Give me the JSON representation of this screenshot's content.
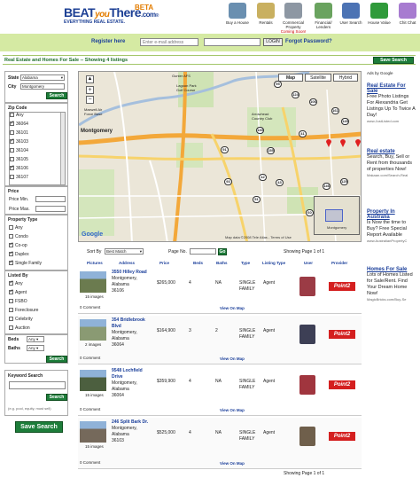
{
  "header": {
    "logo_beat": "BEAT",
    "logo_you": "you",
    "logo_there": "There",
    "logo_com": ".com",
    "logo_reg": "®",
    "tagline": "EVERYTHING REAL ESTATE.",
    "beta": "BETA",
    "nav": [
      {
        "label": "Buy a House",
        "icon": "house-icon"
      },
      {
        "label": "Rentals",
        "icon": "for-rent-sign-icon"
      },
      {
        "label": "Commercial Property",
        "sub": "Coming Soon!",
        "icon": "building-icon"
      },
      {
        "label": "Financial/ Lenders",
        "icon": "handshake-icon"
      },
      {
        "label": "User Search",
        "icon": "magnifier-icon"
      },
      {
        "label": "House Value",
        "icon": "dollar-icon"
      },
      {
        "label": "Chit Chat",
        "icon": "chat-icon"
      }
    ]
  },
  "login": {
    "register": "Register here",
    "email_placeholder": "Enter e-mail address",
    "login_button": "LOGIN",
    "forgot": "Forgot Password?"
  },
  "title": {
    "text": "Real Estate and Homes For Sale -- Showing 4 listings",
    "save_search": "Save Search"
  },
  "sidebar": {
    "state_label": "State",
    "state_value": "Alabama",
    "city_label": "City",
    "city_value": "Montgomery",
    "search_button": "Search",
    "zip_label": "Zip Code",
    "zips": [
      {
        "code": "Any",
        "checked": false
      },
      {
        "code": "36064",
        "checked": true
      },
      {
        "code": "36101",
        "checked": false
      },
      {
        "code": "36103",
        "checked": true
      },
      {
        "code": "36104",
        "checked": false
      },
      {
        "code": "36105",
        "checked": false
      },
      {
        "code": "36106",
        "checked": true
      },
      {
        "code": "36107",
        "checked": false
      }
    ],
    "price_label": "Price",
    "price_min": "Price Min.",
    "price_max": "Price Max.",
    "ptype_label": "Property Type",
    "ptypes": [
      {
        "name": "Any",
        "checked": false
      },
      {
        "name": "Condo",
        "checked": false
      },
      {
        "name": "Co-op",
        "checked": true
      },
      {
        "name": "Duplex",
        "checked": true
      },
      {
        "name": "Single Family",
        "checked": true
      }
    ],
    "listed_label": "Listed By",
    "listed": [
      {
        "name": "Any",
        "checked": true
      },
      {
        "name": "Agent",
        "checked": true
      },
      {
        "name": "FSBO",
        "checked": false
      },
      {
        "name": "Foreclosure",
        "checked": false
      },
      {
        "name": "Celebrity",
        "checked": false
      },
      {
        "name": "Auction",
        "checked": false
      }
    ],
    "beds_label": "Beds",
    "beds_value": "Any",
    "baths_label": "Baths",
    "baths_value": "Any",
    "search2": "Search",
    "keyword_label": "Keyword Search",
    "keyword_hint": "(e.g. pool, equity, must sell)",
    "search3": "Search",
    "save_search": "Save Search"
  },
  "map": {
    "tabs": [
      "Map",
      "Satellite",
      "Hybrid"
    ],
    "copyright": "Map data ©2008 Tele Atlas - Terms of Use",
    "google": "Google",
    "places": [
      "Gunter AFS",
      "Lagoon Park Golf Course",
      "Maxwell Air Force Base",
      "Arrowhead Country Club",
      "Montgomery",
      "Montgomery"
    ],
    "markers": [
      "95",
      "124",
      "106",
      "161",
      "130",
      "145",
      "41",
      "155",
      "91",
      "42",
      "93",
      "43",
      "146",
      "125",
      "51",
      "60"
    ]
  },
  "results": {
    "sort_label": "Sort By",
    "sort_value": "Best Match",
    "page_label": "Page No.",
    "go": "Go",
    "showing_top": "Showing Page 1 of 1",
    "showing_bottom": "Showing Page 1 of 1",
    "columns": [
      "Pictures",
      "Address",
      "Price",
      "Beds",
      "Baths",
      "Type",
      "Listing Type",
      "User",
      "Provider"
    ],
    "listings": [
      {
        "images": "15 images",
        "street": "3550 Hilley Road",
        "city": "Montgomery, Alabama",
        "zip": "36106",
        "price": "$265,000",
        "beds": "4",
        "baths": "NA",
        "type": "SINGLE FAMILY",
        "listing": "Agent",
        "comments": "0 Comment",
        "map": "View On Map"
      },
      {
        "images": "2 images",
        "street": "354 Bridlebrook Blvd",
        "city": "Montgomery, Alabama",
        "zip": "36064",
        "price": "$164,900",
        "beds": "3",
        "baths": "2",
        "type": "SINGLE FAMILY",
        "listing": "Agent",
        "comments": "0 Comment",
        "map": "View On Map"
      },
      {
        "images": "15 images",
        "street": "9548 Lochfield Drive",
        "city": "Montgomery, Alabama",
        "zip": "36064",
        "price": "$359,900",
        "beds": "4",
        "baths": "NA",
        "type": "SINGLE FAMILY",
        "listing": "Agent",
        "comments": "0 Comment",
        "map": "View On Map"
      },
      {
        "images": "15 images",
        "street": "246 Split Bark Dr.",
        "city": "Montgomery, Alabama",
        "zip": "36103",
        "price": "$525,000",
        "beds": "4",
        "baths": "NA",
        "type": "SINGLE FAMILY",
        "listing": "Agent",
        "comments": "0 Comment",
        "map": "View On Map"
      }
    ],
    "provider_logo": "Point2"
  },
  "ads": {
    "adsby": "Ads by Google",
    "items": [
      {
        "title": "Real Estate For Sale",
        "text": "Free Photo Listings For Alexandria Get Listings Up To Twice A Day!",
        "url": "www.JustListed.com"
      },
      {
        "title": "Real estate",
        "text": "Search, Buy, Sell or Rent from thousands of properties Now!",
        "url": "Makaan.com/Search-Real"
      },
      {
        "title": "Property In Australia",
        "text": "Is Now the time to Buy? Free Special Report Available",
        "url": "www.AustralianPropertyC"
      },
      {
        "title": "Homes For Sale",
        "text": "Lots of Homes Listed for Sale/Rent. Find Your Dream Home Now!",
        "url": "MagicBricks.com/Buy-Se"
      }
    ]
  },
  "colors": {
    "accent_green": "#1d7d3a",
    "login_bar": "#d5eaa3",
    "link_blue": "#1a3e9a",
    "orange": "#e37c00"
  }
}
